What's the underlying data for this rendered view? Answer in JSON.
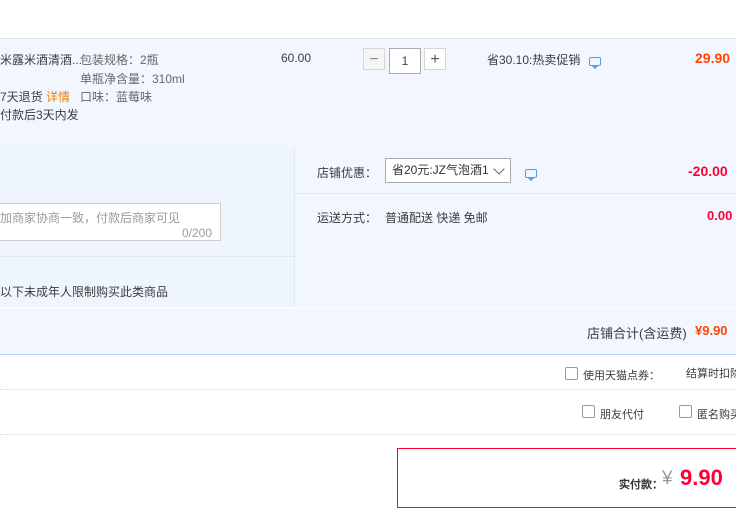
{
  "item": {
    "title": "米露米酒清酒...",
    "spec_pack": "包装规格：2瓶",
    "spec_volume": "单瓶净含量：310ml",
    "spec_flavor": "口味：蓝莓味",
    "return_policy": "7天退货",
    "return_detail_link": "详情",
    "ship_time": "付款后3天内发",
    "unit_price": "60.00",
    "quantity": "1",
    "promo": "省30.10:热卖促销",
    "subtotal": "29.90"
  },
  "memo": {
    "placeholder": "加商家协商一致，付款后商家可见",
    "counter": "0/200"
  },
  "notice": "以下未成年人限制购买此类商品",
  "shop_discount": {
    "label": "店铺优惠：",
    "selected": "省20元:JZ气泡酒1",
    "amount": "-20.00"
  },
  "shipping": {
    "label": "运送方式：",
    "value": "普通配送 快递 免邮",
    "amount": "0.00"
  },
  "shop_total": {
    "label": "店铺合计(含运费)",
    "amount": "¥9.90"
  },
  "options": {
    "tmall_points": "使用天猫点券：",
    "checkout_hint": "结算时扣除",
    "friend_pay": "朋友代付",
    "anonymous": "匿名购买"
  },
  "payment": {
    "label": "实付款：",
    "currency": "¥",
    "amount": "9.90"
  },
  "colors": {
    "accent_red": "#ff0036",
    "price_orange": "#ff4400",
    "link_orange": "#f08200",
    "panel_blue": "#f2f7ff"
  }
}
